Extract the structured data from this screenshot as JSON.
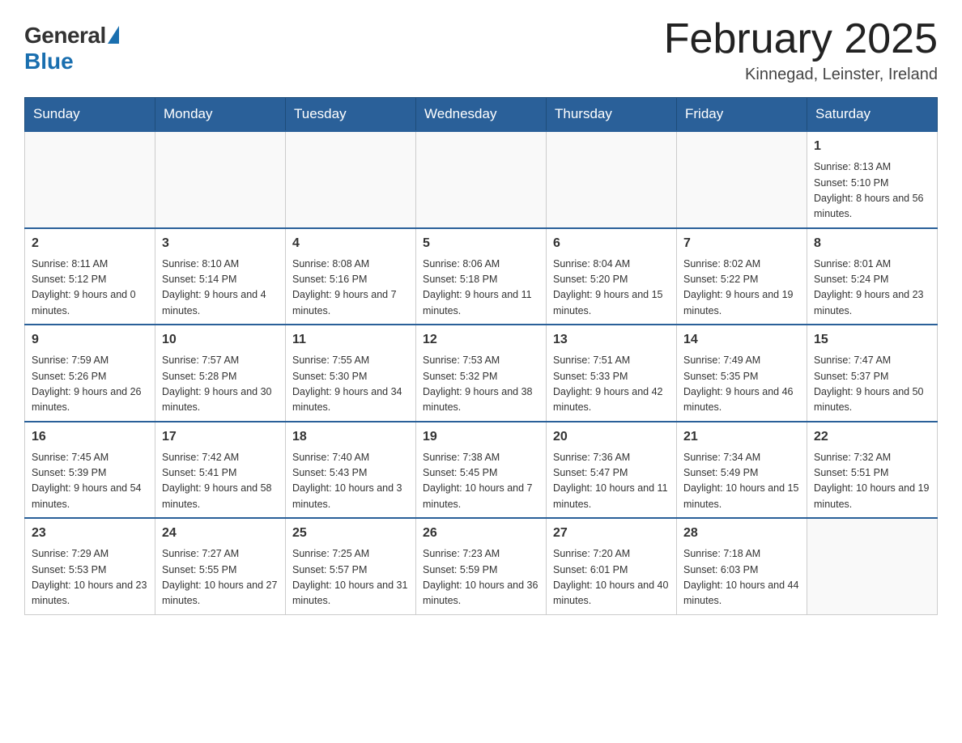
{
  "logo": {
    "general": "General",
    "blue": "Blue"
  },
  "header": {
    "month_title": "February 2025",
    "subtitle": "Kinnegad, Leinster, Ireland"
  },
  "days_of_week": [
    "Sunday",
    "Monday",
    "Tuesday",
    "Wednesday",
    "Thursday",
    "Friday",
    "Saturday"
  ],
  "weeks": [
    [
      {
        "day": "",
        "info": ""
      },
      {
        "day": "",
        "info": ""
      },
      {
        "day": "",
        "info": ""
      },
      {
        "day": "",
        "info": ""
      },
      {
        "day": "",
        "info": ""
      },
      {
        "day": "",
        "info": ""
      },
      {
        "day": "1",
        "info": "Sunrise: 8:13 AM\nSunset: 5:10 PM\nDaylight: 8 hours and 56 minutes."
      }
    ],
    [
      {
        "day": "2",
        "info": "Sunrise: 8:11 AM\nSunset: 5:12 PM\nDaylight: 9 hours and 0 minutes."
      },
      {
        "day": "3",
        "info": "Sunrise: 8:10 AM\nSunset: 5:14 PM\nDaylight: 9 hours and 4 minutes."
      },
      {
        "day": "4",
        "info": "Sunrise: 8:08 AM\nSunset: 5:16 PM\nDaylight: 9 hours and 7 minutes."
      },
      {
        "day": "5",
        "info": "Sunrise: 8:06 AM\nSunset: 5:18 PM\nDaylight: 9 hours and 11 minutes."
      },
      {
        "day": "6",
        "info": "Sunrise: 8:04 AM\nSunset: 5:20 PM\nDaylight: 9 hours and 15 minutes."
      },
      {
        "day": "7",
        "info": "Sunrise: 8:02 AM\nSunset: 5:22 PM\nDaylight: 9 hours and 19 minutes."
      },
      {
        "day": "8",
        "info": "Sunrise: 8:01 AM\nSunset: 5:24 PM\nDaylight: 9 hours and 23 minutes."
      }
    ],
    [
      {
        "day": "9",
        "info": "Sunrise: 7:59 AM\nSunset: 5:26 PM\nDaylight: 9 hours and 26 minutes."
      },
      {
        "day": "10",
        "info": "Sunrise: 7:57 AM\nSunset: 5:28 PM\nDaylight: 9 hours and 30 minutes."
      },
      {
        "day": "11",
        "info": "Sunrise: 7:55 AM\nSunset: 5:30 PM\nDaylight: 9 hours and 34 minutes."
      },
      {
        "day": "12",
        "info": "Sunrise: 7:53 AM\nSunset: 5:32 PM\nDaylight: 9 hours and 38 minutes."
      },
      {
        "day": "13",
        "info": "Sunrise: 7:51 AM\nSunset: 5:33 PM\nDaylight: 9 hours and 42 minutes."
      },
      {
        "day": "14",
        "info": "Sunrise: 7:49 AM\nSunset: 5:35 PM\nDaylight: 9 hours and 46 minutes."
      },
      {
        "day": "15",
        "info": "Sunrise: 7:47 AM\nSunset: 5:37 PM\nDaylight: 9 hours and 50 minutes."
      }
    ],
    [
      {
        "day": "16",
        "info": "Sunrise: 7:45 AM\nSunset: 5:39 PM\nDaylight: 9 hours and 54 minutes."
      },
      {
        "day": "17",
        "info": "Sunrise: 7:42 AM\nSunset: 5:41 PM\nDaylight: 9 hours and 58 minutes."
      },
      {
        "day": "18",
        "info": "Sunrise: 7:40 AM\nSunset: 5:43 PM\nDaylight: 10 hours and 3 minutes."
      },
      {
        "day": "19",
        "info": "Sunrise: 7:38 AM\nSunset: 5:45 PM\nDaylight: 10 hours and 7 minutes."
      },
      {
        "day": "20",
        "info": "Sunrise: 7:36 AM\nSunset: 5:47 PM\nDaylight: 10 hours and 11 minutes."
      },
      {
        "day": "21",
        "info": "Sunrise: 7:34 AM\nSunset: 5:49 PM\nDaylight: 10 hours and 15 minutes."
      },
      {
        "day": "22",
        "info": "Sunrise: 7:32 AM\nSunset: 5:51 PM\nDaylight: 10 hours and 19 minutes."
      }
    ],
    [
      {
        "day": "23",
        "info": "Sunrise: 7:29 AM\nSunset: 5:53 PM\nDaylight: 10 hours and 23 minutes."
      },
      {
        "day": "24",
        "info": "Sunrise: 7:27 AM\nSunset: 5:55 PM\nDaylight: 10 hours and 27 minutes."
      },
      {
        "day": "25",
        "info": "Sunrise: 7:25 AM\nSunset: 5:57 PM\nDaylight: 10 hours and 31 minutes."
      },
      {
        "day": "26",
        "info": "Sunrise: 7:23 AM\nSunset: 5:59 PM\nDaylight: 10 hours and 36 minutes."
      },
      {
        "day": "27",
        "info": "Sunrise: 7:20 AM\nSunset: 6:01 PM\nDaylight: 10 hours and 40 minutes."
      },
      {
        "day": "28",
        "info": "Sunrise: 7:18 AM\nSunset: 6:03 PM\nDaylight: 10 hours and 44 minutes."
      },
      {
        "day": "",
        "info": ""
      }
    ]
  ]
}
